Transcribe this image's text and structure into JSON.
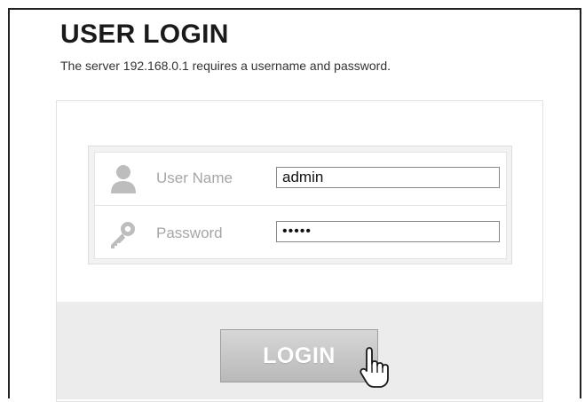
{
  "page": {
    "title": "USER LOGIN",
    "subtitle": "The server  192.168.0.1  requires a username and password."
  },
  "form": {
    "username_label": "User Name",
    "username_value": "admin",
    "password_label": "Password",
    "password_value": "•••••"
  },
  "actions": {
    "login_label": "LOGIN"
  },
  "icons": {
    "user": "user-icon",
    "key": "key-icon",
    "cursor": "hand-pointer-icon"
  },
  "colors": {
    "label_text": "#a6a6a6",
    "button_bg": "#c8c8c8",
    "footer_bg": "#ececec"
  }
}
